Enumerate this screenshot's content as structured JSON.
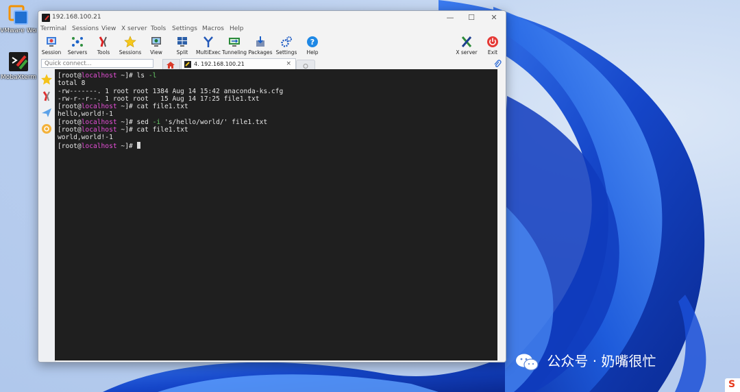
{
  "desktop": {
    "icons": [
      {
        "label": "VMware Workstati...",
        "icon": "vmware-icon"
      },
      {
        "label": "MobaXterm",
        "icon": "mobaxterm-icon"
      }
    ]
  },
  "window": {
    "title": "192.168.100.21",
    "controls": {
      "minimize": "—",
      "maximize": "☐",
      "close": "✕"
    }
  },
  "menu": [
    "Terminal",
    "Sessions",
    "View",
    "X server",
    "Tools",
    "Settings",
    "Macros",
    "Help"
  ],
  "toolbar": {
    "left": [
      {
        "label": "Session",
        "icon": "session-icon"
      },
      {
        "label": "Servers",
        "icon": "servers-icon"
      },
      {
        "label": "Tools",
        "icon": "tools-icon"
      },
      {
        "label": "Sessions",
        "icon": "sessions-star-icon"
      },
      {
        "label": "View",
        "icon": "view-icon"
      },
      {
        "label": "Split",
        "icon": "split-icon"
      },
      {
        "label": "MultiExec",
        "icon": "multiexec-icon"
      },
      {
        "label": "Tunneling",
        "icon": "tunneling-icon"
      },
      {
        "label": "Packages",
        "icon": "packages-icon"
      },
      {
        "label": "Settings",
        "icon": "settings-gears-icon"
      },
      {
        "label": "Help",
        "icon": "help-icon"
      }
    ],
    "right": [
      {
        "label": "X server",
        "icon": "x-server-icon"
      },
      {
        "label": "Exit",
        "icon": "power-icon"
      }
    ]
  },
  "tabs": {
    "quick_connect_placeholder": "Quick connect...",
    "session_tab_label": "4. 192.168.100.21",
    "session_tab_close": "×"
  },
  "terminal": {
    "lines": [
      {
        "user": "[root@",
        "host": "localhost",
        "rest": " ~]# ",
        "cmd": "ls ",
        "flag": "-l"
      },
      {
        "text": "total 8"
      },
      {
        "text": "-rw-------. 1 root root 1384 Aug 14 15:42 anaconda-ks.cfg"
      },
      {
        "text": "-rw-r--r--. 1 root root   15 Aug 14 17:25 file1.txt"
      },
      {
        "user": "[root@",
        "host": "localhost",
        "rest": " ~]# ",
        "cmd": "cat file1.txt"
      },
      {
        "text": "hello,world!-1"
      },
      {
        "user": "[root@",
        "host": "localhost",
        "rest": " ~]# ",
        "cmd": "sed ",
        "flag": "-i",
        "cmd2": " 's/hello/world/' file1.txt"
      },
      {
        "user": "[root@",
        "host": "localhost",
        "rest": " ~]# ",
        "cmd": "cat file1.txt"
      },
      {
        "text": "world,world!-1"
      },
      {
        "user": "[root@",
        "host": "localhost",
        "rest": " ~]# ",
        "cursor": true
      }
    ]
  },
  "watermark": {
    "text": "公众号 · 奶嘴很忙"
  },
  "corner_badge": "S"
}
